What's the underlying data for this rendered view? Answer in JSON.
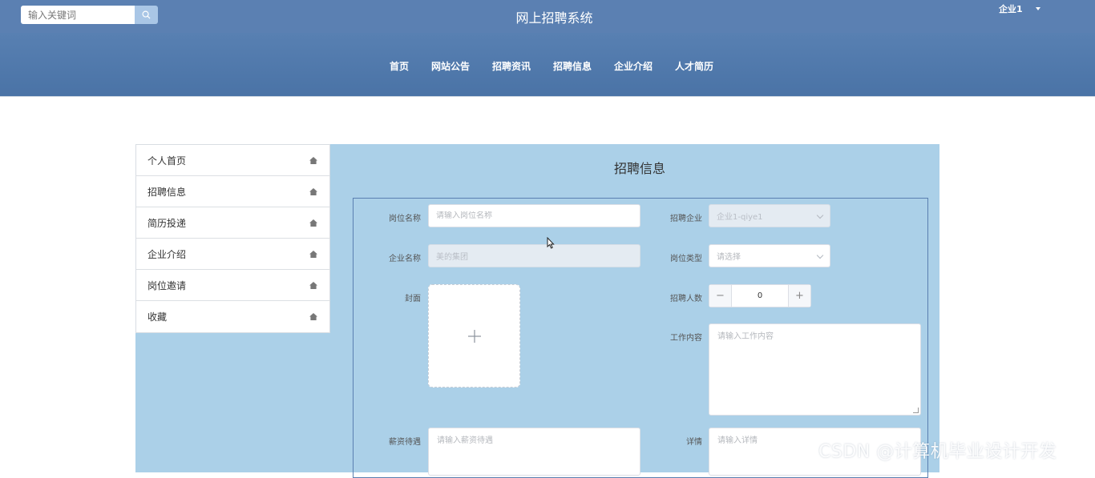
{
  "header": {
    "search_placeholder": "输入关键词",
    "site_title": "网上招聘系统",
    "user_name": "企业1"
  },
  "nav": {
    "items": [
      {
        "label": "首页"
      },
      {
        "label": "网站公告"
      },
      {
        "label": "招聘资讯"
      },
      {
        "label": "招聘信息"
      },
      {
        "label": "企业介绍"
      },
      {
        "label": "人才简历"
      }
    ]
  },
  "sidebar": {
    "items": [
      {
        "label": "个人首页",
        "icon": "home-icon"
      },
      {
        "label": "招聘信息",
        "icon": "home-icon"
      },
      {
        "label": "简历投递",
        "icon": "home-icon"
      },
      {
        "label": "企业介绍",
        "icon": "home-icon"
      },
      {
        "label": "岗位邀请",
        "icon": "home-icon"
      },
      {
        "label": "收藏",
        "icon": "home-icon"
      }
    ]
  },
  "form": {
    "title": "招聘信息",
    "job_name": {
      "label": "岗位名称",
      "placeholder": "请输入岗位名称"
    },
    "recruit_company": {
      "label": "招聘企业",
      "value": "企业1-qiye1"
    },
    "company_name": {
      "label": "企业名称",
      "value": "美的集团"
    },
    "job_type": {
      "label": "岗位类型",
      "placeholder": "请选择"
    },
    "cover": {
      "label": "封面"
    },
    "headcount": {
      "label": "招聘人数",
      "value": "0"
    },
    "job_content": {
      "label": "工作内容",
      "placeholder": "请输入工作内容"
    },
    "salary": {
      "label": "薪资待遇",
      "placeholder": "请输入薪资待遇"
    },
    "details": {
      "label": "详情",
      "placeholder": "请输入详情"
    }
  },
  "watermark": "CSDN @计算机毕业设计开发",
  "colors": {
    "topbar": "#5b80b2",
    "navband": "#4a73a6",
    "panel": "#abd0e8",
    "form_border": "#5a7fb0"
  }
}
